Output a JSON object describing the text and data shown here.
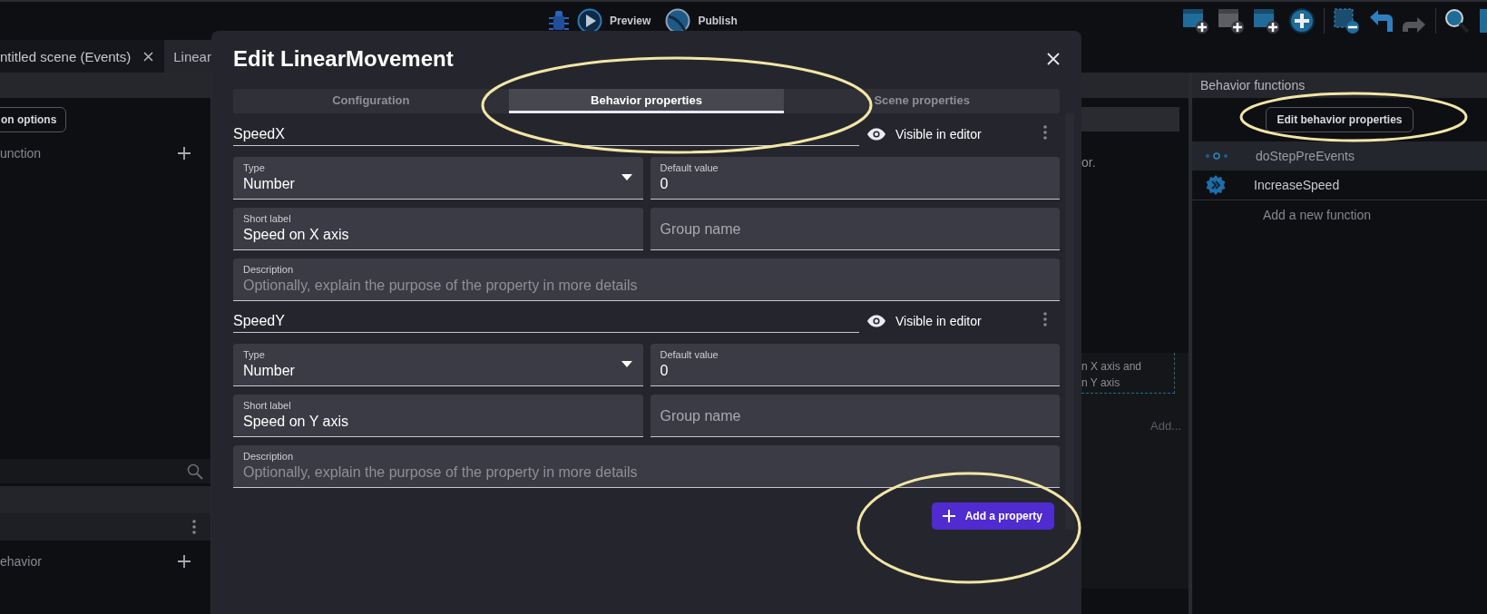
{
  "toolbar": {
    "preview": "Preview",
    "publish": "Publish"
  },
  "editor_tabs": [
    {
      "label": "ntitled scene (Events)",
      "selected": false,
      "closable": true
    },
    {
      "label": "Linear",
      "selected": true,
      "closable": false
    }
  ],
  "left_panel": {
    "options_button": "on options",
    "function_row": "unction",
    "behavior_row": "ehavior"
  },
  "middle_panel": {
    "text": "or.",
    "description_lines": [
      "n X axis and",
      "n Y axis"
    ],
    "add_link": "Add..."
  },
  "right_panel": {
    "title": "Behavior functions",
    "edit_button": "Edit behavior properties",
    "functions": [
      {
        "name": "doStepPreEvents",
        "selected": true,
        "kind": "lifecycle"
      },
      {
        "name": "IncreaseSpeed",
        "selected": false,
        "kind": "action"
      }
    ],
    "add_function": "Add a new function"
  },
  "dialog": {
    "title": "Edit LinearMovement",
    "tabs": [
      {
        "label": "Configuration",
        "selected": false
      },
      {
        "label": "Behavior properties",
        "selected": true
      },
      {
        "label": "Scene properties",
        "selected": false
      }
    ],
    "properties": [
      {
        "name": "SpeedX",
        "visibility": "Visible in editor",
        "type_label": "Type",
        "type": "Number",
        "default_label": "Default value",
        "default": "0",
        "short_label_label": "Short label",
        "short_label": "Speed on X axis",
        "group_placeholder": "Group name",
        "description_label": "Description",
        "description_placeholder": "Optionally, explain the purpose of the property in more details"
      },
      {
        "name": "SpeedY",
        "visibility": "Visible in editor",
        "type_label": "Type",
        "type": "Number",
        "default_label": "Default value",
        "default": "0",
        "short_label_label": "Short label",
        "short_label": "Speed on Y axis",
        "group_placeholder": "Group name",
        "description_label": "Description",
        "description_placeholder": "Optionally, explain the purpose of the property in more details"
      }
    ],
    "add_button": "Add a property"
  },
  "annotations": [
    {
      "kind": "ellipse"
    },
    {
      "kind": "ellipse"
    },
    {
      "kind": "ellipse"
    }
  ]
}
